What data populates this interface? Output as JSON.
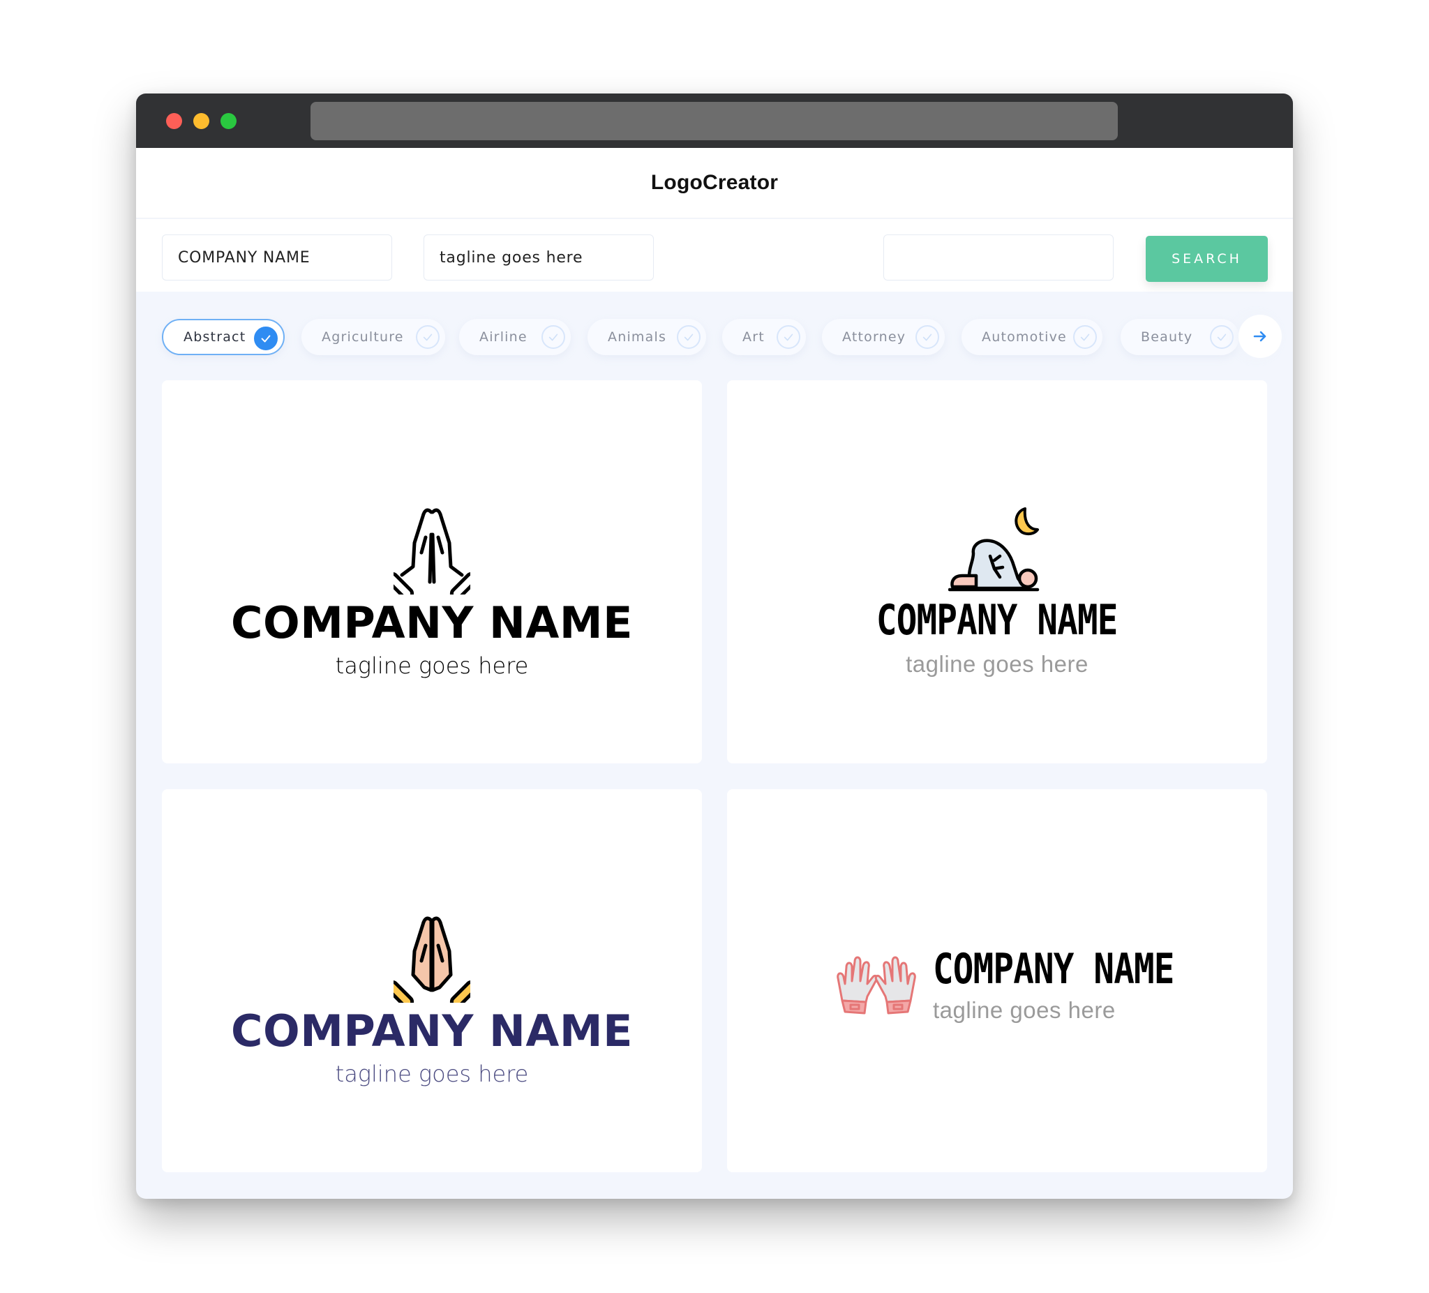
{
  "window": {
    "title_bar": {
      "buttons": [
        "close",
        "minimize",
        "maximize"
      ],
      "colors": {
        "close": "#fe5f57",
        "minimize": "#febc2e",
        "maximize": "#2ac840"
      }
    }
  },
  "header": {
    "brand": "LogoCreator"
  },
  "search": {
    "company_name_value": "COMPANY NAME",
    "tagline_value": "tagline goes here",
    "keyword_value": "",
    "button_label": "SEARCH",
    "button_color": "#5bc8a0"
  },
  "categories": {
    "items": [
      {
        "label": "Abstract",
        "selected": true
      },
      {
        "label": "Agriculture",
        "selected": false
      },
      {
        "label": "Airline",
        "selected": false
      },
      {
        "label": "Animals",
        "selected": false
      },
      {
        "label": "Art",
        "selected": false
      },
      {
        "label": "Attorney",
        "selected": false
      },
      {
        "label": "Automotive",
        "selected": false
      },
      {
        "label": "Beauty",
        "selected": false
      }
    ],
    "next_icon": "arrow-right-icon",
    "accent": "#2f8cf2"
  },
  "logos": [
    {
      "icon": "praying-hands-outline-icon",
      "company": "COMPANY NAME",
      "tagline": "tagline goes here",
      "name_color": "#000000",
      "tagline_color": "#333333"
    },
    {
      "icon": "prostrating-prayer-moon-icon",
      "company": "COMPANY NAME",
      "tagline": "tagline goes here",
      "name_color": "#000000",
      "tagline_color": "#9a9a9a"
    },
    {
      "icon": "praying-hands-color-icon",
      "company": "COMPANY NAME",
      "tagline": "tagline goes here",
      "name_color": "#2b2a66",
      "tagline_color": "#4a4a80"
    },
    {
      "icon": "gloves-icon",
      "company": "COMPANY NAME",
      "tagline": "tagline goes here",
      "name_color": "#000000",
      "tagline_color": "#9a9a9a"
    }
  ]
}
